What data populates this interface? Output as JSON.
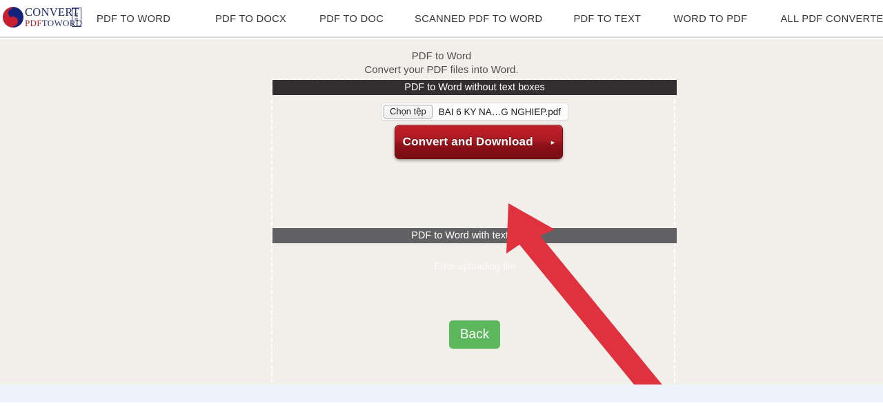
{
  "header": {
    "logo": {
      "name": "convertpdftoword-logo",
      "line1": "CONVERT",
      "line2_pdf": "PDF",
      "line2_toword": "TOWORD",
      "tld": ".net"
    },
    "nav": [
      {
        "label": "PDF TO WORD",
        "name": "nav-pdf-to-word",
        "has_caret": false
      },
      {
        "label": "PDF TO DOCX",
        "name": "nav-pdf-to-docx",
        "has_caret": false
      },
      {
        "label": "PDF TO DOC",
        "name": "nav-pdf-to-doc",
        "has_caret": false
      },
      {
        "label": "SCANNED PDF TO WORD",
        "name": "nav-scanned-pdf-to-word",
        "has_caret": false
      },
      {
        "label": "PDF TO TEXT",
        "name": "nav-pdf-to-text",
        "has_caret": false
      },
      {
        "label": "WORD TO PDF",
        "name": "nav-word-to-pdf",
        "has_caret": false
      },
      {
        "label": "ALL PDF CONVERTER",
        "name": "nav-all-pdf-converter",
        "has_caret": true
      }
    ],
    "caret_glyph": "▾"
  },
  "main": {
    "title": "PDF to Word",
    "subtitle": "Convert your PDF files into Word.",
    "section_without_textboxes": {
      "header": "PDF to Word without text boxes",
      "file_input": {
        "button_label": "Chọn tệp",
        "file_name": "BAI 6 KY NA…G NGHIEP.pdf"
      },
      "convert_button": {
        "label": "Convert and Download",
        "arrow_glyph": "▸"
      }
    },
    "section_with_textboxes": {
      "header": "PDF to Word with text boxes",
      "error_message": "Error uploading file",
      "back_button": "Back"
    }
  },
  "annotation": {
    "arrow_name": "red-annotation-arrow",
    "color": "#e0313f"
  },
  "colors": {
    "page_background": "#f2efea",
    "footer_band": "#eef2fa",
    "bar_dark": "#332f30",
    "bar_gray": "#616163",
    "convert_red": "#a81a22",
    "back_green": "#5cb85c",
    "logo_navy": "#26336e",
    "logo_red": "#c02027"
  }
}
